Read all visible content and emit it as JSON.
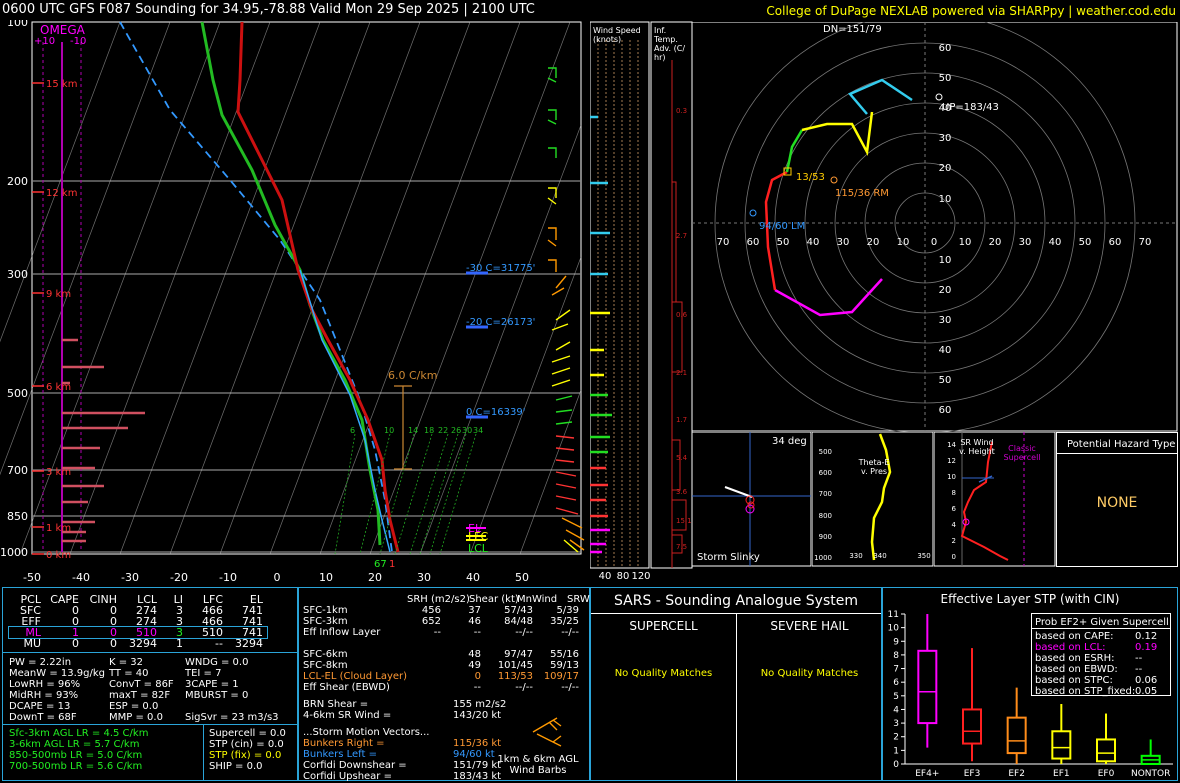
{
  "header": {
    "title": "0600 UTC GFS F087 Sounding for 34.95,-78.88 Valid  Mon 29 Sep 2025 | 2100 UTC",
    "credit": "College of DuPage NEXLAB powered via SHARPpy | weather.cod.edu"
  },
  "skewt": {
    "omega_label": "OMEGA",
    "omega_plus": "+10",
    "omega_minus": "-10",
    "pressure_levels": [
      "100",
      "200",
      "300",
      "500",
      "700",
      "850",
      "1000"
    ],
    "temp_ticks": [
      "-50",
      "-40",
      "-30",
      "-20",
      "-10",
      "0",
      "10",
      "20",
      "30",
      "40",
      "50"
    ],
    "height_labels": [
      "15 km",
      "12 km",
      "9 km",
      "6 km",
      "3 km",
      "1 km",
      "0 km"
    ],
    "isotherm_labels": [
      "-30 C=31775'",
      "-20 C=26173'",
      "0 C=16339'"
    ],
    "lapse_label": "6.0 C/km",
    "mixing_labels": [
      "6",
      "10",
      "14",
      "18",
      "22",
      "26",
      "30",
      "34"
    ],
    "parcel_labels": [
      "EL",
      "LFC",
      "LCL"
    ],
    "sfc_dew": "67",
    "sfc_temp": "1"
  },
  "wind_panel": {
    "speed_label": "Wind Speed (knots)",
    "speed_ticks": [
      "40",
      "80",
      "120"
    ],
    "inf_temp_label": "Inf. Temp. Adv. (C/ hr)",
    "inf_values": [
      "0.3",
      "2.7",
      "0.6",
      "2.1",
      "1.7",
      "5.4",
      "3.6",
      "15.1",
      "7.5"
    ]
  },
  "hodograph": {
    "dn_label": "DN=151/79",
    "up_label": "UP=183/43",
    "rm_label": "115/36 RM",
    "lm_label": "94/60 LM",
    "mean_label": "13/53",
    "rings": [
      "60",
      "50",
      "40",
      "30",
      "20",
      "10"
    ],
    "x_ticks": [
      "70",
      "60",
      "50",
      "40",
      "30",
      "20",
      "10",
      "0",
      "10",
      "20",
      "30",
      "40",
      "50",
      "60",
      "70"
    ]
  },
  "insets": {
    "slinky_label": "Storm Slinky",
    "slinky_deg": "34 deg",
    "thetae_label": "Theta-E v. Pres",
    "thetae_levels": [
      "500",
      "600",
      "700",
      "800",
      "900",
      "1000"
    ],
    "thetae_ticks": [
      "330",
      "340",
      "350"
    ],
    "srwind_label": "SR Wind v. Height",
    "srwind_heights": [
      "14",
      "12",
      "10",
      "8",
      "6",
      "4",
      "2",
      "0"
    ],
    "classic_label": "Classic Supercell",
    "hazard_title": "Potential Hazard Type",
    "hazard_value": "NONE"
  },
  "parcels": {
    "headers": [
      "PCL",
      "CAPE",
      "CINH",
      "LCL",
      "LI",
      "LFC",
      "EL"
    ],
    "rows": [
      [
        "SFC",
        "0",
        "0",
        "274",
        "3",
        "466",
        "741"
      ],
      [
        "EFF",
        "0",
        "0",
        "274",
        "3",
        "466",
        "741"
      ],
      [
        "ML",
        "1",
        "0",
        "510",
        "3",
        "510",
        "741"
      ],
      [
        "MU",
        "0",
        "0",
        "3294",
        "1",
        "--",
        "3294"
      ]
    ]
  },
  "thermo": [
    [
      "PW = 2.22in",
      "K = 32",
      "WNDG = 0.0"
    ],
    [
      "MeanW = 13.9g/kg",
      "TT = 40",
      "TEI = 7"
    ],
    [
      "LowRH = 96%",
      "ConvT = 86F",
      "3CAPE = 1"
    ],
    [
      "MidRH = 93%",
      "maxT = 82F",
      "MBURST = 0"
    ],
    [
      "DCAPE = 13",
      "ESP = 0.0",
      ""
    ],
    [
      "DownT = 68F",
      "MMP = 0.0",
      "SigSvr = 23 m3/s3"
    ]
  ],
  "lapse_rates": [
    "Sfc-3km AGL LR = 4.5 C/km",
    "3-6km AGL LR = 5.7 C/km",
    "850-500mb LR = 5.0 C/km",
    "700-500mb LR = 5.6 C/km"
  ],
  "composites": [
    "Supercell = 0.0",
    "STP (cin) = 0.0",
    "STP (fix) = 0.0",
    "SHIP = 0.0"
  ],
  "kinematics": {
    "headers": [
      "SRH (m2/s2)",
      "Shear (kt)",
      "MnWind",
      "SRW"
    ],
    "rows": [
      [
        "SFC-1km",
        "456",
        "37",
        "57/43",
        "5/39"
      ],
      [
        "SFC-3km",
        "652",
        "46",
        "84/48",
        "35/25"
      ],
      [
        "Eff Inflow Layer",
        "--",
        "--",
        "--/--",
        "--/--"
      ],
      [
        "SFC-6km",
        "48",
        "97/47",
        "55/16",
        ""
      ],
      [
        "SFC-8km",
        "49",
        "101/45",
        "59/13",
        ""
      ],
      [
        "LCL-EL (Cloud Layer)",
        "0",
        "113/53",
        "109/17",
        ""
      ],
      [
        "Eff Shear (EBWD)",
        "--",
        "--/--",
        "--/--",
        ""
      ]
    ],
    "brn_shear_label": "BRN Shear =",
    "brn_shear": "155 m2/s2",
    "sr_wind_label": "4-6km SR Wind =",
    "sr_wind": "143/20 kt",
    "storm_motion_title": "...Storm Motion Vectors...",
    "bunkers_right_label": "Bunkers Right =",
    "bunkers_right": "115/36 kt",
    "bunkers_left_label": "Bunkers Left =",
    "bunkers_left": "94/60 kt",
    "corfidi_down_label": "Corfidi Downshear =",
    "corfidi_down": "151/79 kt",
    "corfidi_up_label": "Corfidi Upshear =",
    "corfidi_up": "183/43 kt",
    "barbs_label": "1km & 6km AGL Wind Barbs"
  },
  "sars": {
    "title": "SARS - Sounding Analogue System",
    "supercell": "SUPERCELL",
    "hail": "SEVERE HAIL",
    "supercell_msg": "No Quality Matches",
    "hail_msg": "No Quality Matches"
  },
  "stp": {
    "title": "Effective Layer STP (with CIN)",
    "prob_title": "Prob EF2+ Given Supercell",
    "prob_rows": [
      [
        "based on CAPE:",
        "0.12"
      ],
      [
        "based on LCL:",
        "0.19"
      ],
      [
        "based on ESRH:",
        "--"
      ],
      [
        "based on EBWD:",
        "--"
      ],
      [
        "based on STPC:",
        "0.06"
      ],
      [
        "based on STP_fixed:",
        "0.05"
      ]
    ],
    "y_ticks": [
      "0",
      "1",
      "2",
      "3",
      "4",
      "5",
      "6",
      "7",
      "8",
      "9",
      "10",
      "11"
    ],
    "categories": [
      "EF4+",
      "EF3",
      "EF2",
      "EF1",
      "EF0",
      "NONTOR"
    ],
    "colors": [
      "#ff00ff",
      "#ff2020",
      "#ff8c1a",
      "#ffff00",
      "#ffff00",
      "#00ff00"
    ]
  },
  "chart_data": {
    "type": "box",
    "title": "Effective Layer STP (with CIN)",
    "categories": [
      "EF4+",
      "EF3",
      "EF2",
      "EF1",
      "EF0",
      "NONTOR"
    ],
    "ylim": [
      0,
      11
    ],
    "boxes": [
      {
        "low": 1.2,
        "q1": 3.0,
        "median": 5.3,
        "q3": 8.3,
        "high": 11.0
      },
      {
        "low": 0.2,
        "q1": 1.5,
        "median": 2.4,
        "q3": 4.0,
        "high": 8.5
      },
      {
        "low": 0.0,
        "q1": 0.8,
        "median": 1.7,
        "q3": 3.4,
        "high": 5.6
      },
      {
        "low": 0.0,
        "q1": 0.4,
        "median": 1.2,
        "q3": 2.4,
        "high": 4.4
      },
      {
        "low": 0.0,
        "q1": 0.2,
        "median": 0.8,
        "q3": 1.8,
        "high": 3.7
      },
      {
        "low": 0.0,
        "q1": 0.0,
        "median": 0.3,
        "q3": 0.6,
        "high": 1.8
      }
    ]
  }
}
